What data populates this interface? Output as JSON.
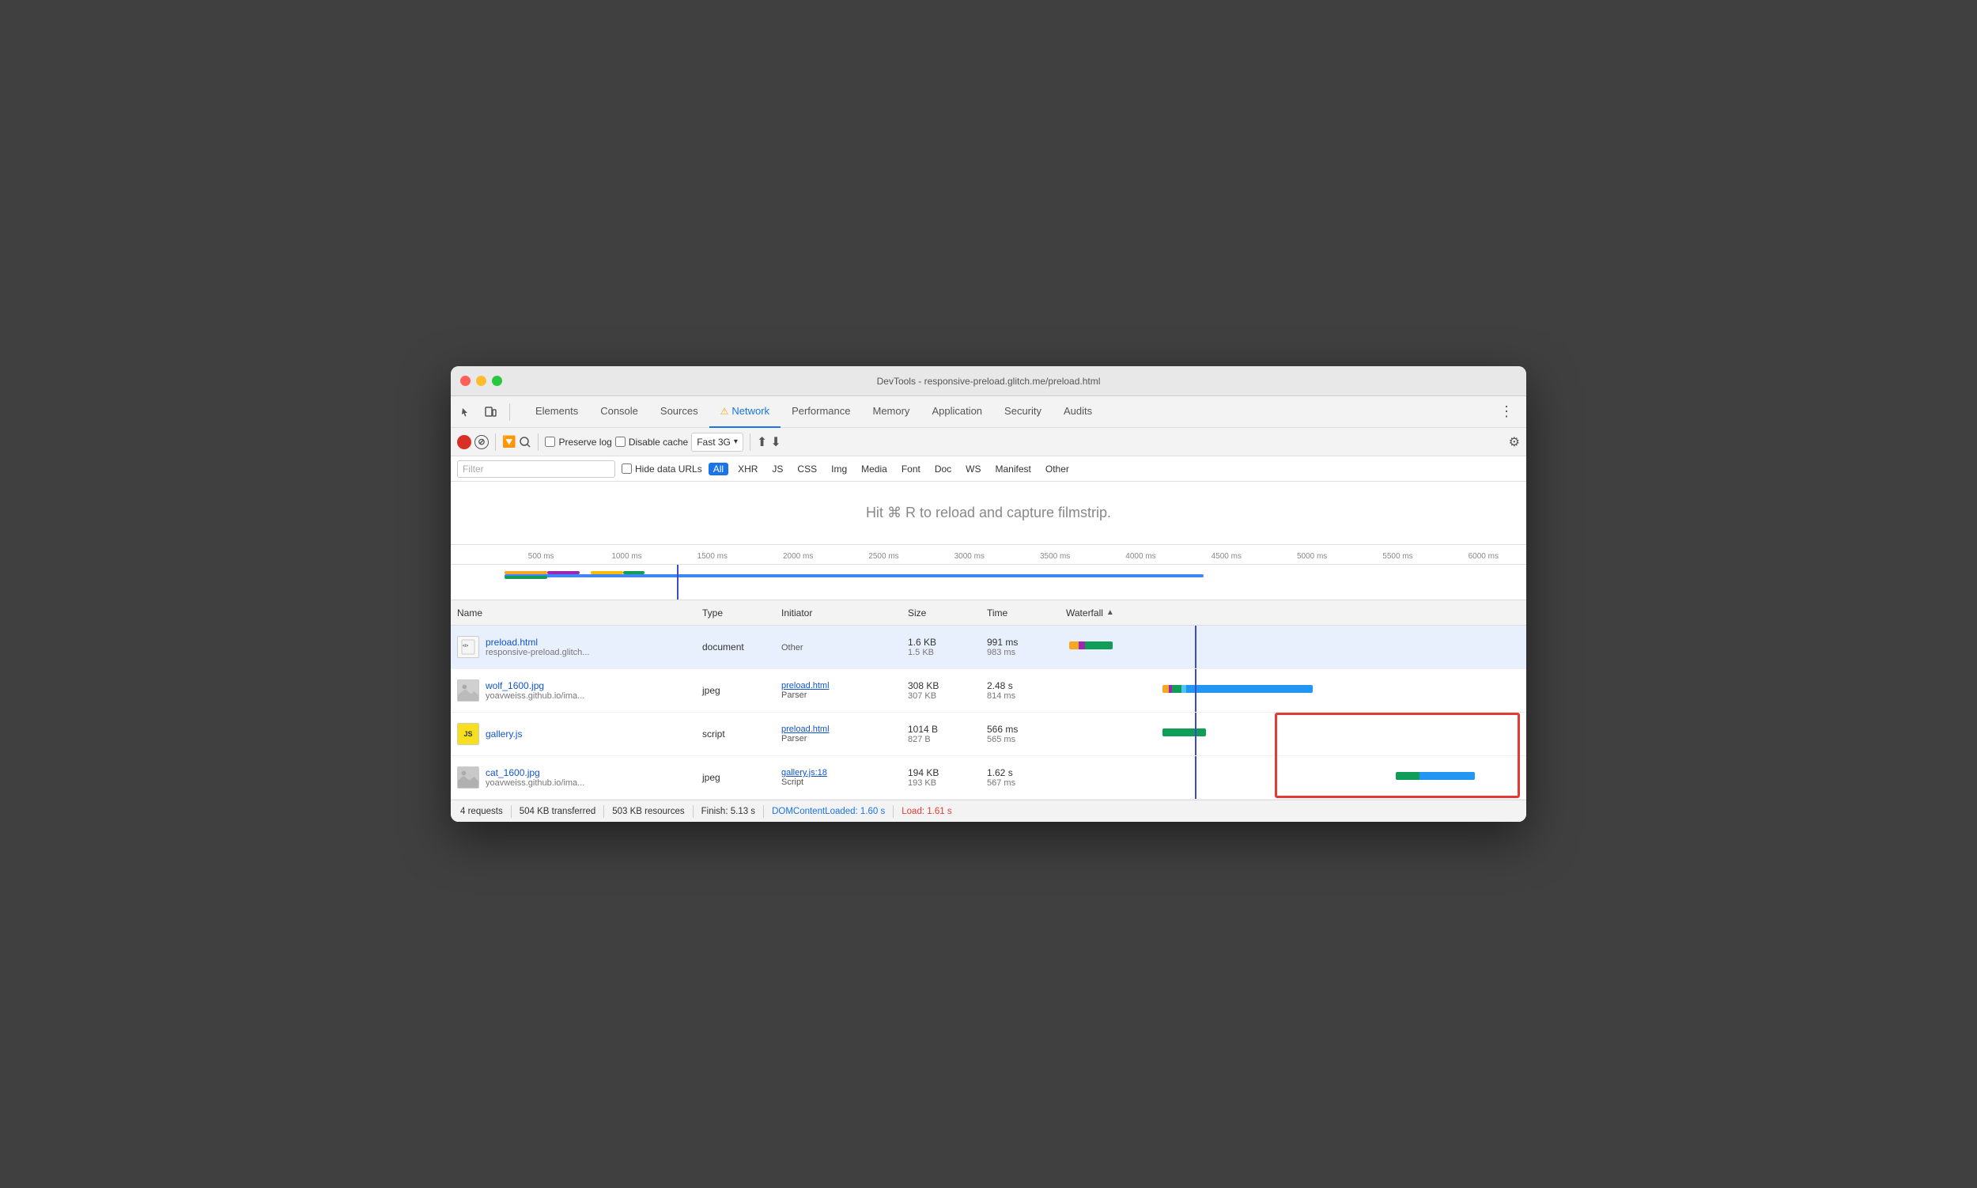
{
  "window": {
    "title": "DevTools - responsive-preload.glitch.me/preload.html"
  },
  "tabs": {
    "items": [
      {
        "label": "Elements",
        "active": false
      },
      {
        "label": "Console",
        "active": false
      },
      {
        "label": "Sources",
        "active": false
      },
      {
        "label": "Network",
        "active": true,
        "warning": true
      },
      {
        "label": "Performance",
        "active": false
      },
      {
        "label": "Memory",
        "active": false
      },
      {
        "label": "Application",
        "active": false
      },
      {
        "label": "Security",
        "active": false
      },
      {
        "label": "Audits",
        "active": false
      }
    ]
  },
  "toolbar": {
    "preserve_log": "Preserve log",
    "disable_cache": "Disable cache",
    "throttle": "Fast 3G",
    "filter_placeholder": "Filter"
  },
  "filter_tags": [
    {
      "label": "All",
      "active": true
    },
    {
      "label": "XHR",
      "active": false
    },
    {
      "label": "JS",
      "active": false
    },
    {
      "label": "CSS",
      "active": false
    },
    {
      "label": "Img",
      "active": false
    },
    {
      "label": "Media",
      "active": false
    },
    {
      "label": "Font",
      "active": false
    },
    {
      "label": "Doc",
      "active": false
    },
    {
      "label": "WS",
      "active": false
    },
    {
      "label": "Manifest",
      "active": false
    },
    {
      "label": "Other",
      "active": false
    }
  ],
  "hide_data_urls": "Hide data URLs",
  "filmstrip": {
    "text": "Hit ⌘ R to reload and capture filmstrip."
  },
  "timeline": {
    "marks": [
      "500 ms",
      "1000 ms",
      "1500 ms",
      "2000 ms",
      "2500 ms",
      "3000 ms",
      "3500 ms",
      "4000 ms",
      "4500 ms",
      "5000 ms",
      "5500 ms",
      "6000 ms"
    ]
  },
  "table": {
    "headers": [
      "Name",
      "Type",
      "Initiator",
      "Size",
      "Time",
      "Waterfall"
    ],
    "rows": [
      {
        "name": "preload.html",
        "url": "responsive-preload.glitch...",
        "type": "document",
        "initiator": "Other",
        "initiator_link": null,
        "size_top": "1.6 KB",
        "size_bottom": "1.5 KB",
        "time_top": "991 ms",
        "time_bottom": "983 ms",
        "selected": true
      },
      {
        "name": "wolf_1600.jpg",
        "url": "yoavweiss.github.io/ima...",
        "type": "jpeg",
        "initiator": "preload.html",
        "initiator_sub": "Parser",
        "initiator_link": true,
        "size_top": "308 KB",
        "size_bottom": "307 KB",
        "time_top": "2.48 s",
        "time_bottom": "814 ms",
        "selected": false
      },
      {
        "name": "gallery.js",
        "url": "",
        "type": "script",
        "initiator": "preload.html",
        "initiator_sub": "Parser",
        "initiator_link": true,
        "size_top": "1014 B",
        "size_bottom": "827 B",
        "time_top": "566 ms",
        "time_bottom": "565 ms",
        "selected": false
      },
      {
        "name": "cat_1600.jpg",
        "url": "yoavweiss.github.io/ima...",
        "type": "jpeg",
        "initiator": "gallery.js:18",
        "initiator_sub": "Script",
        "initiator_link": true,
        "size_top": "194 KB",
        "size_bottom": "193 KB",
        "time_top": "1.62 s",
        "time_bottom": "567 ms",
        "selected": false
      }
    ]
  },
  "status": {
    "requests": "4 requests",
    "transferred": "504 KB transferred",
    "resources": "503 KB resources",
    "finish": "Finish: 5.13 s",
    "dom_content": "DOMContentLoaded: 1.60 s",
    "load": "Load: 1.61 s"
  }
}
